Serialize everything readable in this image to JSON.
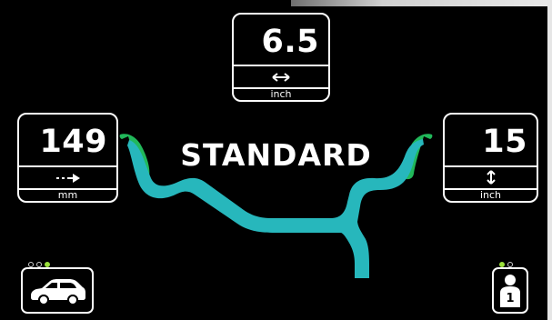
{
  "top_card": {
    "value": "6.5",
    "unit": "inch",
    "icon": "horizontal-double-arrow-icon"
  },
  "left_card": {
    "value": "149",
    "unit": "mm",
    "icon": "dashed-right-arrow-icon"
  },
  "right_card": {
    "value": "15",
    "unit": "inch",
    "icon": "vertical-double-arrow-icon"
  },
  "mode_label": "STANDARD",
  "wheel_profile": {
    "profile_color": "#27b7bc",
    "weight_color": "#21b85a",
    "icon": "rim-profile-icon"
  },
  "vehicle_selector": {
    "icon": "car-icon",
    "dots": [
      {
        "active": false
      },
      {
        "active": false
      },
      {
        "active": true
      }
    ]
  },
  "user_selector": {
    "icon": "user-icon",
    "badge": "1",
    "dots": [
      {
        "active": true
      },
      {
        "active": false
      }
    ]
  },
  "colors": {
    "background": "#000000",
    "foreground": "#ffffff",
    "accent_green": "#9be03b"
  }
}
